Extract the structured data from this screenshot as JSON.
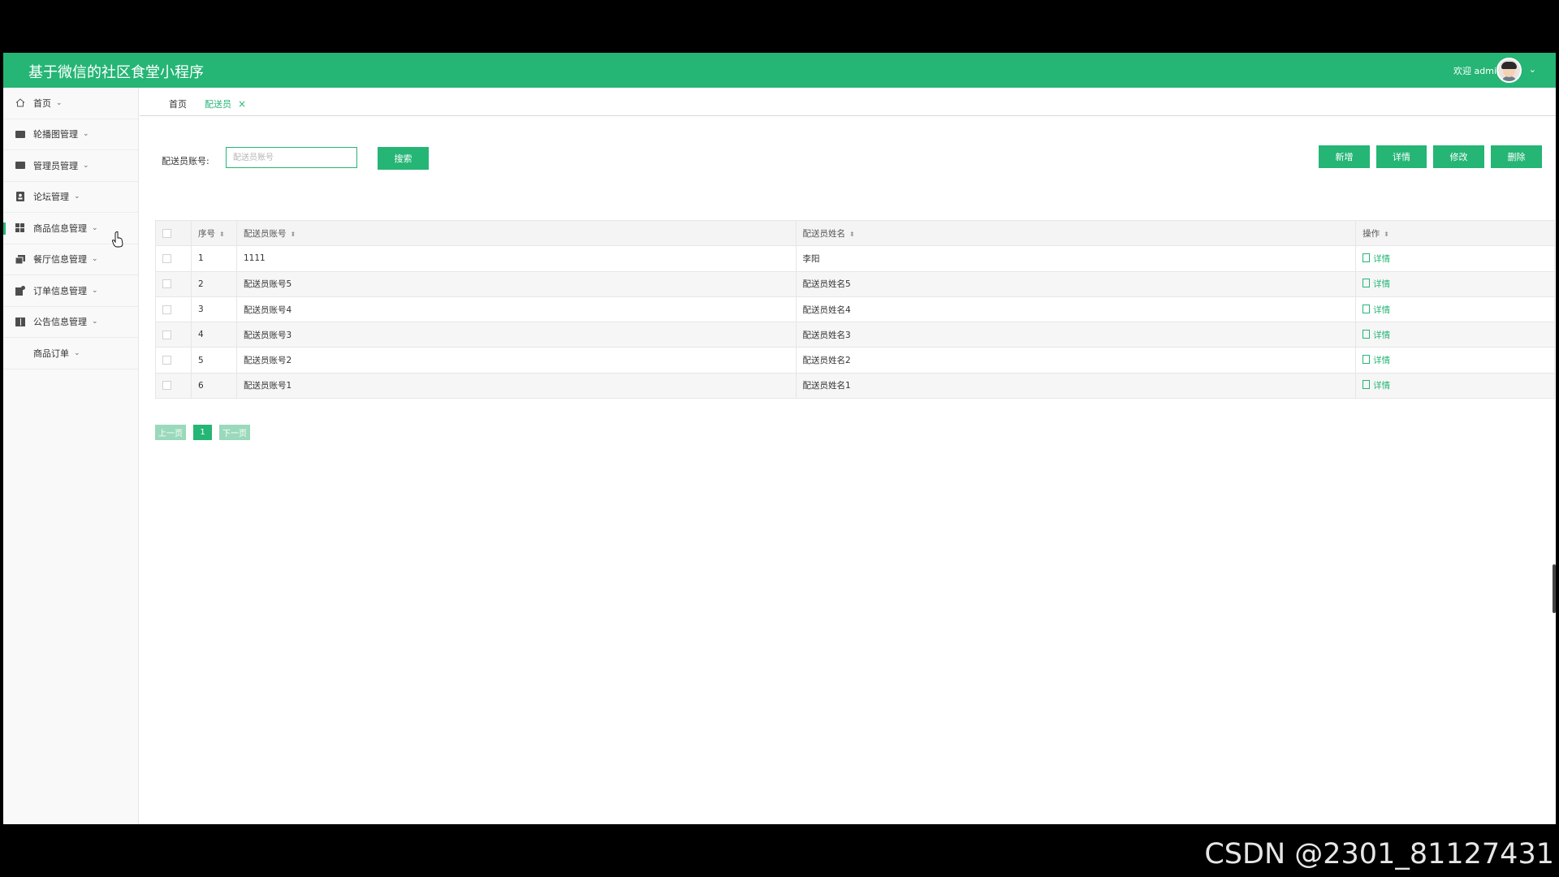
{
  "app": {
    "title": "基于微信的社区食堂小程序",
    "welcome": "欢迎 admin",
    "accent_color": "#25b575"
  },
  "sidebar": {
    "items": [
      {
        "label": "首页",
        "icon": "home-icon"
      },
      {
        "label": "轮播图管理",
        "icon": "carousel-icon"
      },
      {
        "label": "管理员管理",
        "icon": "admin-icon"
      },
      {
        "label": "论坛管理",
        "icon": "forum-icon"
      },
      {
        "label": "商品信息管理",
        "icon": "grid-icon"
      },
      {
        "label": "餐厅信息管理",
        "icon": "restaurant-icon"
      },
      {
        "label": "订单信息管理",
        "icon": "order-icon"
      },
      {
        "label": "公告信息管理",
        "icon": "notice-icon"
      },
      {
        "label": "商品订单",
        "icon": ""
      }
    ]
  },
  "tabs": [
    {
      "label": "首页"
    },
    {
      "label": "配送员",
      "close": "×"
    }
  ],
  "search": {
    "label": "配送员账号:",
    "placeholder": "配送员账号",
    "button": "搜索"
  },
  "actions": {
    "add": "新增",
    "detail": "详情",
    "edit": "修改",
    "delete": "删除"
  },
  "table": {
    "headers": [
      "序号",
      "配送员账号",
      "配送员姓名",
      "操作"
    ],
    "rows": [
      {
        "no": "1",
        "account": "1111",
        "name": "李阳",
        "op": "详情"
      },
      {
        "no": "2",
        "account": "配送员账号5",
        "name": "配送员姓名5",
        "op": "详情"
      },
      {
        "no": "3",
        "account": "配送员账号4",
        "name": "配送员姓名4",
        "op": "详情"
      },
      {
        "no": "4",
        "account": "配送员账号3",
        "name": "配送员姓名3",
        "op": "详情"
      },
      {
        "no": "5",
        "account": "配送员账号2",
        "name": "配送员姓名2",
        "op": "详情"
      },
      {
        "no": "6",
        "account": "配送员账号1",
        "name": "配送员姓名1",
        "op": "详情"
      }
    ]
  },
  "pagination": {
    "prev": "上一页",
    "current": "1",
    "next": "下一页"
  },
  "watermark": "CSDN @2301_81127431"
}
